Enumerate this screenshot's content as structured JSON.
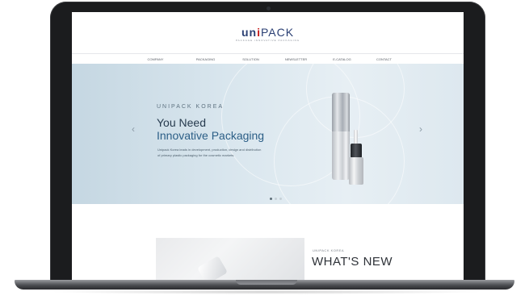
{
  "logo": {
    "text_u": "un",
    "text_mark": "i",
    "text_rest": "PACK",
    "tagline": "PACKAGE INNOVATIVE PACKAGING"
  },
  "nav": {
    "items": [
      {
        "label": "COMPANY"
      },
      {
        "label": "PACKAGING"
      },
      {
        "label": "SOLUTION"
      },
      {
        "label": "NEWSLETTER"
      },
      {
        "label": "E-CATALOG"
      },
      {
        "label": "CONTACT"
      }
    ]
  },
  "hero": {
    "eyebrow": "UNIPACK KOREA",
    "title_line1": "You Need",
    "title_line2": "Innovative Packaging",
    "description": "Unipack Korea leads in development, production, design and distribution of primary plastic packaging for the cosmetic markets.",
    "prev_arrow": "‹",
    "next_arrow": "›",
    "slides_total": 3,
    "active_slide": 1
  },
  "news": {
    "label": "UNIPACK KOREA",
    "title": "WHAT'S NEW"
  },
  "colors": {
    "accent": "#2b5e86",
    "logo_red": "#c8201f",
    "logo_blue": "#2a3f73"
  },
  "icons": {
    "prev": "chevron-left-icon",
    "next": "chevron-right-icon"
  }
}
